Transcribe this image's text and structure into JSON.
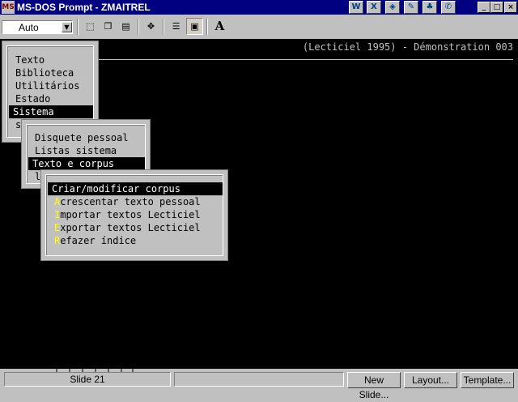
{
  "window": {
    "title": "MS-DOS Prompt - ZMAITREL",
    "icon_label": "MS",
    "controls": {
      "minimize": "_",
      "maximize": "□",
      "close": "×"
    }
  },
  "titlebar_apps": [
    {
      "name": "word-icon",
      "glyph": "W"
    },
    {
      "name": "excel-icon",
      "glyph": "X"
    },
    {
      "name": "presentation-icon",
      "glyph": "◈"
    },
    {
      "name": "schedule-icon",
      "glyph": "✎"
    },
    {
      "name": "binder-icon",
      "glyph": "♣"
    },
    {
      "name": "office-icon",
      "glyph": "✆"
    }
  ],
  "toolbar": {
    "font_size": "Auto",
    "tools": [
      {
        "name": "mark-icon",
        "glyph": "⬚"
      },
      {
        "name": "copy-icon",
        "glyph": "❐"
      },
      {
        "name": "paste-icon",
        "glyph": "▤"
      },
      {
        "name": "fullscreen-icon",
        "glyph": "✥"
      },
      {
        "name": "properties-icon",
        "glyph": "☰"
      },
      {
        "name": "background-icon",
        "glyph": "▣"
      },
      {
        "name": "font-icon",
        "glyph": "A"
      }
    ]
  },
  "console": {
    "header": "(Lecticiel 1995) - Démonstration 003",
    "main_menu": {
      "items": [
        {
          "label": "Texto"
        },
        {
          "label": "Biblioteca"
        },
        {
          "label": "Utilitários"
        },
        {
          "label": "Estado"
        },
        {
          "label": "Sistema"
        },
        {
          "label": "s"
        }
      ],
      "selected": "Sistema"
    },
    "sistema_menu": {
      "items": [
        {
          "label": "Disquete pessoal"
        },
        {
          "label": "Listas sistema"
        },
        {
          "label": "Texto e corpus"
        },
        {
          "label": "l"
        }
      ],
      "selected": "Texto e corpus"
    },
    "corpus_menu": {
      "items": [
        {
          "hot": "C",
          "rest": "riar/modificar corpus"
        },
        {
          "hot": "A",
          "rest": "crescentar texto pessoal"
        },
        {
          "hot": "I",
          "rest": "mportar textos Lecticiel"
        },
        {
          "hot": "E",
          "rest": "xportar textos Lecticiel"
        },
        {
          "hot": "R",
          "rest": "efazer índice"
        }
      ],
      "selected": "Criar/modificar corpus"
    }
  },
  "statusbar": {
    "slide": "Slide 21",
    "buttons": [
      "New Slide...",
      "Layout...",
      "Template..."
    ]
  }
}
